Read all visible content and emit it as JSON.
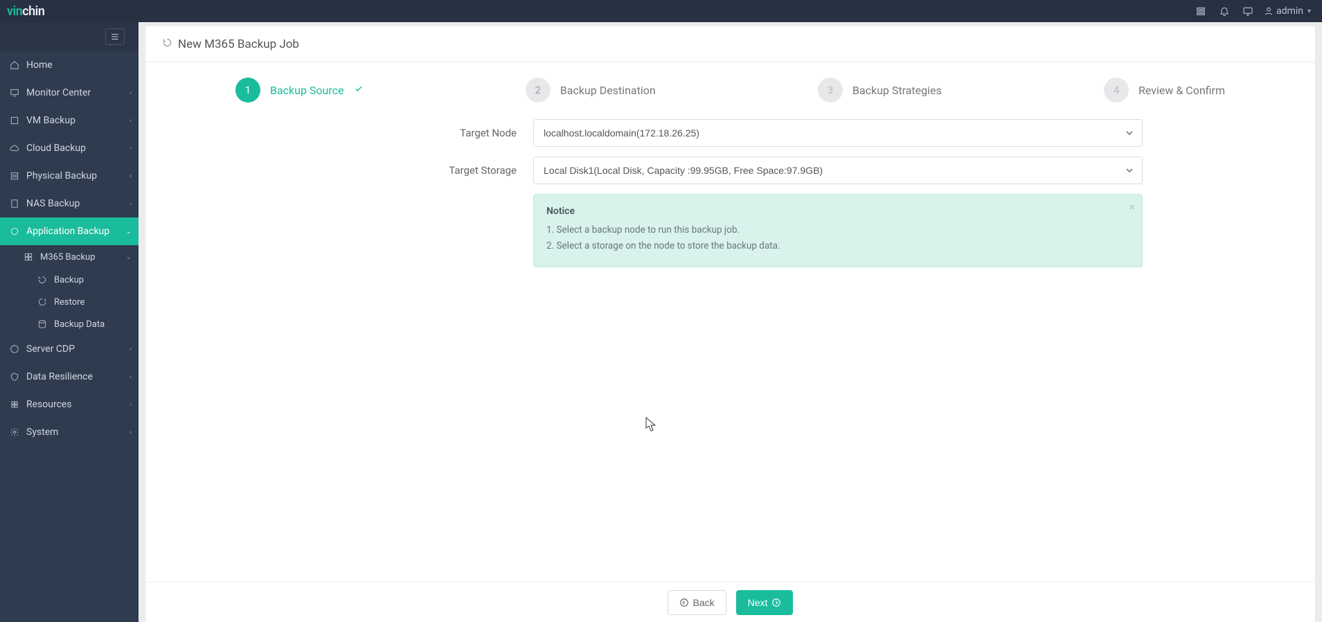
{
  "brand": {
    "part1": "vin",
    "part2": "chin"
  },
  "top": {
    "username": "admin"
  },
  "sidebar": {
    "items": [
      {
        "label": "Home"
      },
      {
        "label": "Monitor Center"
      },
      {
        "label": "VM Backup"
      },
      {
        "label": "Cloud Backup"
      },
      {
        "label": "Physical Backup"
      },
      {
        "label": "NAS Backup"
      },
      {
        "label": "Application Backup"
      },
      {
        "label": "M365 Backup"
      },
      {
        "label": "Backup"
      },
      {
        "label": "Restore"
      },
      {
        "label": "Backup Data"
      },
      {
        "label": "Server CDP"
      },
      {
        "label": "Data Resilience"
      },
      {
        "label": "Resources"
      },
      {
        "label": "System"
      }
    ]
  },
  "page": {
    "title": "New M365 Backup Job"
  },
  "steps": [
    {
      "num": "1",
      "label": "Backup Source"
    },
    {
      "num": "2",
      "label": "Backup Destination"
    },
    {
      "num": "3",
      "label": "Backup Strategies"
    },
    {
      "num": "4",
      "label": "Review & Confirm"
    }
  ],
  "form": {
    "target_node_label": "Target Node",
    "target_node_value": "localhost.localdomain(172.18.26.25)",
    "target_storage_label": "Target Storage",
    "target_storage_value": "Local Disk1(Local Disk, Capacity :99.95GB, Free Space:97.9GB)"
  },
  "notice": {
    "title": "Notice",
    "line1": "1. Select a backup node to run this backup job.",
    "line2": "2. Select a storage on the node to store the backup data."
  },
  "footer": {
    "back_label": "Back",
    "next_label": "Next"
  }
}
